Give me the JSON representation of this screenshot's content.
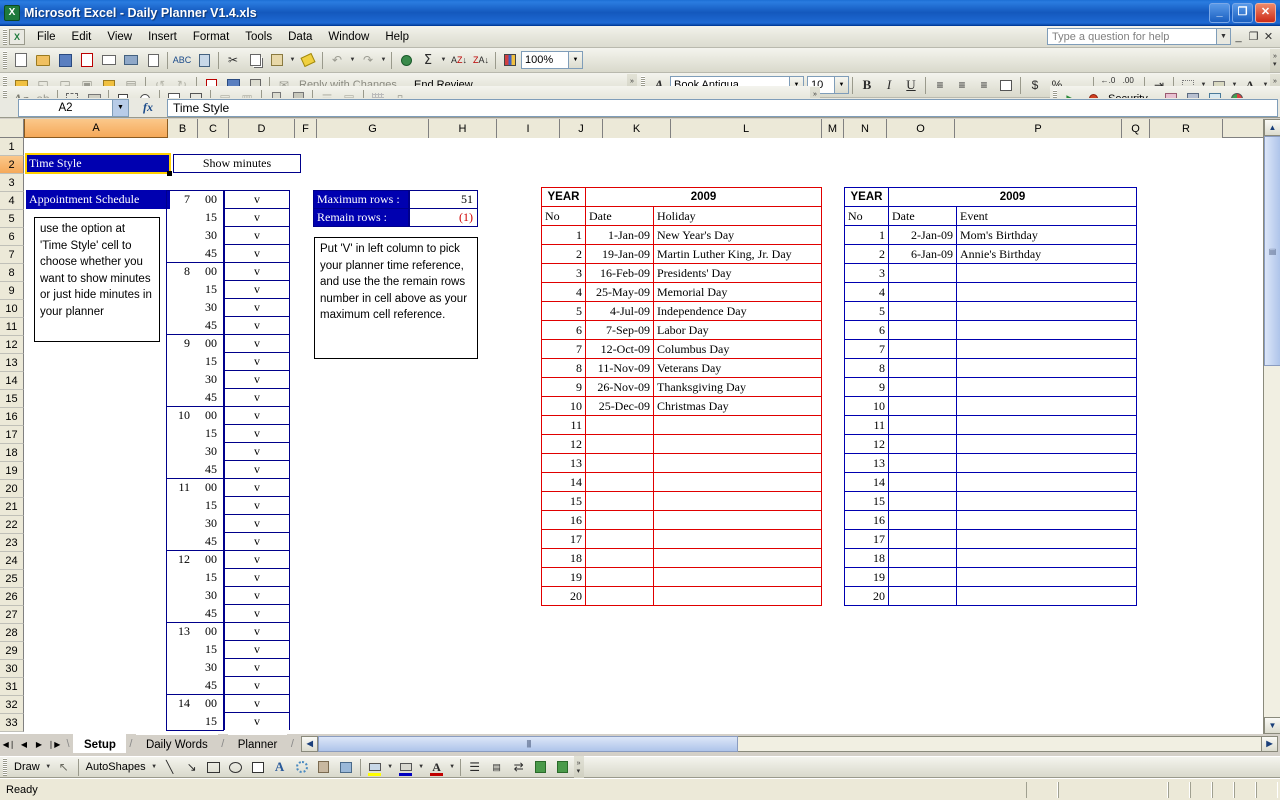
{
  "window": {
    "title": "Microsoft Excel - Daily Planner V1.4.xls",
    "app_icon": "excel-icon",
    "minimize": "_",
    "restore": "❐",
    "close": "✕"
  },
  "menubar": {
    "items": [
      "File",
      "Edit",
      "View",
      "Insert",
      "Format",
      "Tools",
      "Data",
      "Window",
      "Help"
    ],
    "help_placeholder": "Type a question for help",
    "doc_minimize": "_",
    "doc_restore": "❐",
    "doc_close": "✕"
  },
  "toolbars": {
    "standard": {
      "zoom": "100%",
      "buttons": [
        "new-icon",
        "open-icon",
        "save-icon",
        "permission-icon",
        "email-icon",
        "print-icon",
        "print-preview-icon",
        "spelling-icon",
        "research-icon",
        "cut-icon",
        "copy-icon",
        "paste-icon",
        "format-painter-icon",
        "undo-icon",
        "redo-icon",
        "hyperlink-icon",
        "autosum-icon",
        "sort-asc-icon",
        "sort-desc-icon",
        "chart-wizard-icon"
      ]
    },
    "reviewing": {
      "reply_label": "Reply with Changes...",
      "end_review_label": "End Review...",
      "buttons": [
        "new-comment-icon",
        "previous-comment-icon",
        "next-comment-icon",
        "hide-comment-icon",
        "show-all-comments-icon",
        "delete-comment-icon",
        "track-changes-icon",
        "reject-icon",
        "highlight-changes-icon",
        "save-version-icon",
        "mail-recipient-icon"
      ]
    },
    "formatting": {
      "font": "Book Antiqua",
      "size": "10",
      "bold": "B",
      "italic": "I",
      "underline": "U",
      "currency": "$",
      "percent": "%",
      "comma": ",",
      "buttons": [
        "align-left-icon",
        "align-center-icon",
        "align-right-icon",
        "merge-center-icon",
        "increase-decimal-icon",
        "decrease-decimal-icon",
        "increase-indent-icon",
        "borders-icon",
        "fill-color-icon",
        "font-color-icon"
      ]
    },
    "forms": {
      "buttons": [
        "label-icon",
        "edit-box-icon",
        "group-box-icon",
        "button-icon",
        "check-box-icon",
        "option-button-icon",
        "list-box-icon",
        "combo-box-icon",
        "combo-list-edit-icon",
        "combo-drop-down-icon",
        "scroll-bar-icon",
        "spinner-icon",
        "control-properties-icon",
        "edit-code-icon",
        "toggle-grid-icon",
        "run-dialog-icon"
      ]
    },
    "visual_basic": {
      "security_label": "Security...",
      "buttons": [
        "run-macro-icon",
        "record-macro-icon",
        "security-icon",
        "visual-basic-editor-icon",
        "microsoft-script-editor-icon",
        "control-toolbox-icon",
        "design-mode-icon"
      ]
    },
    "drawing": {
      "draw_label": "Draw",
      "autoshapes_label": "AutoShapes",
      "buttons": [
        "select-objects-icon",
        "line-icon",
        "arrow-icon",
        "rectangle-icon",
        "oval-icon",
        "text-box-icon",
        "wordart-icon",
        "diagram-icon",
        "clip-art-icon",
        "picture-icon",
        "fill-color-icon",
        "line-color-icon",
        "font-color-icon",
        "line-style-icon",
        "dash-style-icon",
        "arrow-style-icon",
        "shadow-style-icon",
        "3d-style-icon"
      ]
    }
  },
  "formula_bar": {
    "name_box": "A2",
    "fx_label": "fx",
    "formula": "Time Style"
  },
  "grid": {
    "columns": [
      "A",
      "B",
      "C",
      "D",
      "F",
      "G",
      "H",
      "I",
      "J",
      "K",
      "L",
      "M",
      "N",
      "O",
      "P",
      "Q",
      "R"
    ],
    "selected_column": "A",
    "rows": [
      1,
      2,
      3,
      4,
      5,
      6,
      7,
      8,
      9,
      10,
      11,
      12,
      13,
      14,
      15,
      16,
      17,
      18,
      19,
      20,
      21,
      22,
      23,
      24,
      25,
      26,
      27,
      28,
      29,
      30,
      31,
      32,
      33
    ],
    "selected_row": 2
  },
  "sheet": {
    "time_style_label": "Time Style",
    "time_style_value": "Show minutes",
    "appointment_schedule_label": "Appointment Schedule",
    "note_left": "use the option at 'Time Style' cell to choose whether you want to show minutes or just hide minutes in your planner",
    "max_rows_label": "Maximum rows :",
    "max_rows_value": "51",
    "remain_rows_label": "Remain rows :",
    "remain_rows_value": "(1)",
    "note_right": "Put 'V' in left column to pick your planner time reference, and use the the remain rows number in cell above as your maximum cell reference.",
    "schedule": [
      {
        "hour": "7",
        "minute": "00",
        "mark": "v"
      },
      {
        "hour": "",
        "minute": "15",
        "mark": "v"
      },
      {
        "hour": "",
        "minute": "30",
        "mark": "v"
      },
      {
        "hour": "",
        "minute": "45",
        "mark": "v"
      },
      {
        "hour": "8",
        "minute": "00",
        "mark": "v"
      },
      {
        "hour": "",
        "minute": "15",
        "mark": "v"
      },
      {
        "hour": "",
        "minute": "30",
        "mark": "v"
      },
      {
        "hour": "",
        "minute": "45",
        "mark": "v"
      },
      {
        "hour": "9",
        "minute": "00",
        "mark": "v"
      },
      {
        "hour": "",
        "minute": "15",
        "mark": "v"
      },
      {
        "hour": "",
        "minute": "30",
        "mark": "v"
      },
      {
        "hour": "",
        "minute": "45",
        "mark": "v"
      },
      {
        "hour": "10",
        "minute": "00",
        "mark": "v"
      },
      {
        "hour": "",
        "minute": "15",
        "mark": "v"
      },
      {
        "hour": "",
        "minute": "30",
        "mark": "v"
      },
      {
        "hour": "",
        "minute": "45",
        "mark": "v"
      },
      {
        "hour": "11",
        "minute": "00",
        "mark": "v"
      },
      {
        "hour": "",
        "minute": "15",
        "mark": "v"
      },
      {
        "hour": "",
        "minute": "30",
        "mark": "v"
      },
      {
        "hour": "",
        "minute": "45",
        "mark": "v"
      },
      {
        "hour": "12",
        "minute": "00",
        "mark": "v"
      },
      {
        "hour": "",
        "minute": "15",
        "mark": "v"
      },
      {
        "hour": "",
        "minute": "30",
        "mark": "v"
      },
      {
        "hour": "",
        "minute": "45",
        "mark": "v"
      },
      {
        "hour": "13",
        "minute": "00",
        "mark": "v"
      },
      {
        "hour": "",
        "minute": "15",
        "mark": "v"
      },
      {
        "hour": "",
        "minute": "30",
        "mark": "v"
      },
      {
        "hour": "",
        "minute": "45",
        "mark": "v"
      },
      {
        "hour": "14",
        "minute": "00",
        "mark": "v"
      },
      {
        "hour": "",
        "minute": "15",
        "mark": "v"
      }
    ],
    "holiday_table": {
      "year_label": "YEAR",
      "year_value": "2009",
      "headers": [
        "No",
        "Date",
        "Holiday"
      ],
      "border_color": "#e00000",
      "rows": [
        {
          "no": "1",
          "date": "1-Jan-09",
          "name": "New Year's Day"
        },
        {
          "no": "2",
          "date": "19-Jan-09",
          "name": "Martin Luther King, Jr. Day"
        },
        {
          "no": "3",
          "date": "16-Feb-09",
          "name": "Presidents' Day"
        },
        {
          "no": "4",
          "date": "25-May-09",
          "name": "Memorial Day"
        },
        {
          "no": "5",
          "date": "4-Jul-09",
          "name": "Independence Day"
        },
        {
          "no": "6",
          "date": "7-Sep-09",
          "name": "Labor Day"
        },
        {
          "no": "7",
          "date": "12-Oct-09",
          "name": "Columbus Day"
        },
        {
          "no": "8",
          "date": "11-Nov-09",
          "name": "Veterans Day"
        },
        {
          "no": "9",
          "date": "26-Nov-09",
          "name": "Thanksgiving Day"
        },
        {
          "no": "10",
          "date": "25-Dec-09",
          "name": "Christmas Day"
        },
        {
          "no": "11",
          "date": "",
          "name": ""
        },
        {
          "no": "12",
          "date": "",
          "name": ""
        },
        {
          "no": "13",
          "date": "",
          "name": ""
        },
        {
          "no": "14",
          "date": "",
          "name": ""
        },
        {
          "no": "15",
          "date": "",
          "name": ""
        },
        {
          "no": "16",
          "date": "",
          "name": ""
        },
        {
          "no": "17",
          "date": "",
          "name": ""
        },
        {
          "no": "18",
          "date": "",
          "name": ""
        },
        {
          "no": "19",
          "date": "",
          "name": ""
        },
        {
          "no": "20",
          "date": "",
          "name": ""
        }
      ]
    },
    "event_table": {
      "year_label": "YEAR",
      "year_value": "2009",
      "headers": [
        "No",
        "Date",
        "Event"
      ],
      "border_color": "#0000b0",
      "rows": [
        {
          "no": "1",
          "date": "2-Jan-09",
          "name": "Mom's Birthday"
        },
        {
          "no": "2",
          "date": "6-Jan-09",
          "name": "Annie's Birthday"
        },
        {
          "no": "3",
          "date": "",
          "name": ""
        },
        {
          "no": "4",
          "date": "",
          "name": ""
        },
        {
          "no": "5",
          "date": "",
          "name": ""
        },
        {
          "no": "6",
          "date": "",
          "name": ""
        },
        {
          "no": "7",
          "date": "",
          "name": ""
        },
        {
          "no": "8",
          "date": "",
          "name": ""
        },
        {
          "no": "9",
          "date": "",
          "name": ""
        },
        {
          "no": "10",
          "date": "",
          "name": ""
        },
        {
          "no": "11",
          "date": "",
          "name": ""
        },
        {
          "no": "12",
          "date": "",
          "name": ""
        },
        {
          "no": "13",
          "date": "",
          "name": ""
        },
        {
          "no": "14",
          "date": "",
          "name": ""
        },
        {
          "no": "15",
          "date": "",
          "name": ""
        },
        {
          "no": "16",
          "date": "",
          "name": ""
        },
        {
          "no": "17",
          "date": "",
          "name": ""
        },
        {
          "no": "18",
          "date": "",
          "name": ""
        },
        {
          "no": "19",
          "date": "",
          "name": ""
        },
        {
          "no": "20",
          "date": "",
          "name": ""
        }
      ]
    }
  },
  "sheet_tabs": {
    "tabs": [
      "Setup",
      "Daily Words",
      "Planner"
    ],
    "active": "Setup",
    "nav_first": "◀❘",
    "nav_prev": "◀",
    "nav_next": "▶",
    "nav_last": "❘▶"
  },
  "status_bar": {
    "text": "Ready"
  },
  "colors": {
    "accent_blue": "#0000b0",
    "selection_orange": "#f5a95a",
    "holiday_red": "#e00000",
    "title_blue": "#1458bd"
  }
}
